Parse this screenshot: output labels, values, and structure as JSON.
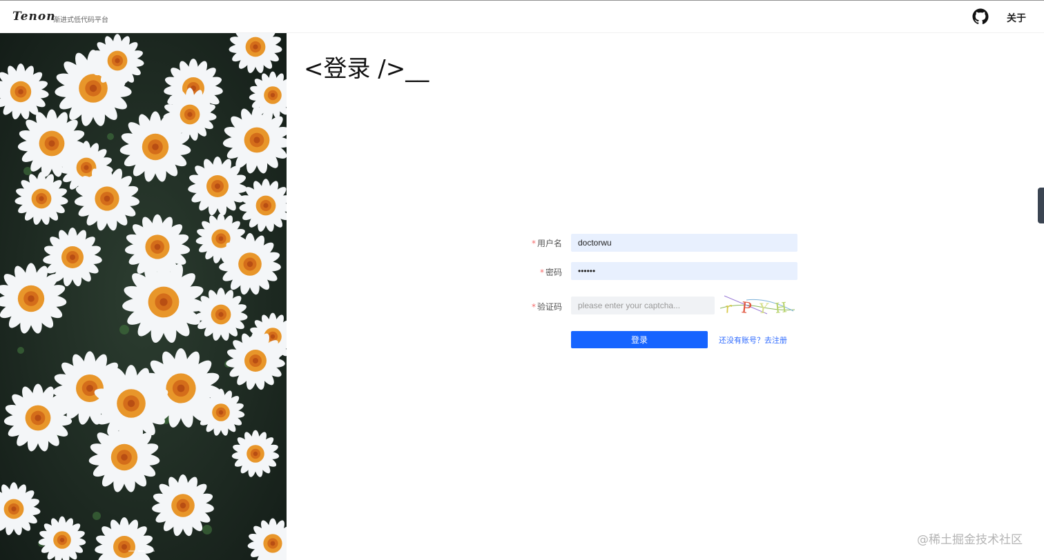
{
  "header": {
    "logo": "Tenon",
    "logo_subtitle": "渐进式低代码平台",
    "github_icon": "github-icon",
    "about_label": "关于"
  },
  "title": "<登录 />__",
  "form": {
    "username": {
      "label": "用户名",
      "value": "doctorwu",
      "required": true
    },
    "password": {
      "label": "密码",
      "value": "••••••",
      "required": true
    },
    "captcha": {
      "label": "验证码",
      "placeholder": "please enter your captcha...",
      "required": true,
      "captcha_text": "rPYH"
    },
    "submit_label": "登录",
    "register_link": "还没有账号？去注册"
  },
  "colors": {
    "primary": "#1664ff",
    "link": "#2f6bff",
    "required": "#f56c6c",
    "autofill_bg": "#e8f0fe"
  },
  "watermark": "@稀土掘金技术社区"
}
